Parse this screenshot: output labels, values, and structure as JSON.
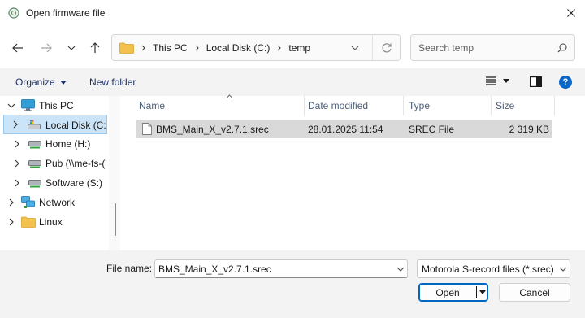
{
  "window": {
    "title": "Open firmware file"
  },
  "address": {
    "crumbs": [
      "This PC",
      "Local Disk (C:)",
      "temp"
    ]
  },
  "search": {
    "placeholder": "Search temp"
  },
  "commands": {
    "organize": "Organize",
    "new_folder": "New folder"
  },
  "tree": {
    "items": [
      {
        "label": "This PC",
        "icon": "monitor-icon",
        "expanded": true
      },
      {
        "label": "Local Disk (C:)",
        "icon": "drive-icon",
        "selected": true
      },
      {
        "label": "Home (H:)",
        "icon": "network-drive-icon"
      },
      {
        "label": "Pub (\\\\me-fs-(",
        "icon": "network-drive-icon"
      },
      {
        "label": "Software (S:)",
        "icon": "network-drive-icon"
      },
      {
        "label": "Network",
        "icon": "network-icon"
      },
      {
        "label": "Linux",
        "icon": "folder-icon"
      }
    ]
  },
  "files": {
    "columns": [
      "Name",
      "Date modified",
      "Type",
      "Size"
    ],
    "rows": [
      {
        "name": "BMS_Main_X_v2.7.1.srec",
        "date": "28.01.2025 11:54",
        "type": "SREC File",
        "size": "2 319 KB"
      }
    ]
  },
  "footer": {
    "file_name_label": "File name:",
    "file_name_value": "BMS_Main_X_v2.7.1.srec",
    "filter": "Motorola S-record files (*.srec)",
    "open": "Open",
    "cancel": "Cancel"
  },
  "colors": {
    "accent": "#0067c0",
    "selection": "#cce4f7",
    "help": "#0e66c6"
  }
}
